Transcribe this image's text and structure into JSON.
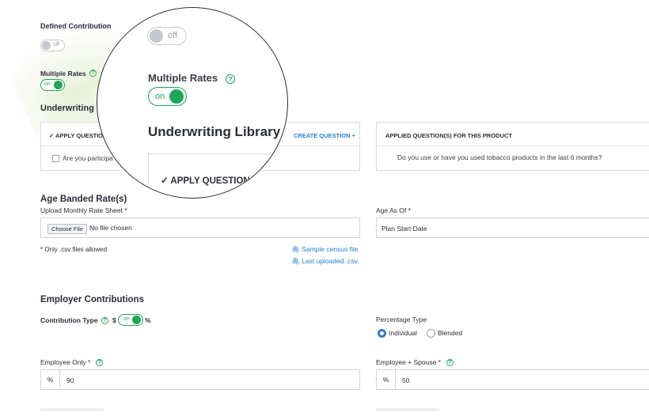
{
  "defined_contribution": {
    "label": "Defined Contribution",
    "toggle_text": "off"
  },
  "multiple_rates": {
    "label": "Multiple Rates",
    "help": "?",
    "toggle_text": "on"
  },
  "underwriting": {
    "title": "Underwriting Library",
    "title_clipped": "Underwriting L",
    "apply_header": "✓ APPLY QUESTIO",
    "create_label": "CREATE QUESTION",
    "create_icon": "+",
    "question_text": "Are you participa",
    "applied_header": "APPLIED QUESTION(S) FOR THIS PRODUCT",
    "applied_question": "Do you use or have you used tobacco products in the last 6 months?"
  },
  "magnifier": {
    "toggle_off_text": "off",
    "multiple_rates_label": "Multiple Rates",
    "help": "?",
    "toggle_on_text": "on",
    "library_title": "Underwriting Library",
    "apply_button": "✓ APPLY QUESTION",
    "edit_icon": "pencil-icon"
  },
  "age_banded": {
    "title": "Age Banded Rate(s)",
    "upload_label": "Upload Monthly Rate Sheet *",
    "choose_button": "Choose File",
    "file_status": "No file chosen",
    "csv_note": "* Only .csv files allowed",
    "sample_link": "Sample census file",
    "last_link": "Last uploaded .csv",
    "age_as_of_label": "Age As Of *",
    "age_as_of_value": "Plan Start Date"
  },
  "employer": {
    "title": "Employer Contributions",
    "contribution_type_label": "Contribution Type",
    "help": "?",
    "dollar": "$",
    "toggle_text": "on",
    "percent": "%",
    "percentage_type_label": "Percentage Type",
    "radio_individual": "Individual",
    "radio_blended": "Blended",
    "employee_only_label": "Employee Only *",
    "employee_only_prefix": "%",
    "employee_only_value": "90",
    "employee_spouse_label": "Employee + Spouse *",
    "employee_spouse_prefix": "%",
    "employee_spouse_value": "50"
  },
  "colors": {
    "accent_green": "#1fa65a",
    "link_blue": "#2a7fd1",
    "text": "#2b2e38"
  }
}
